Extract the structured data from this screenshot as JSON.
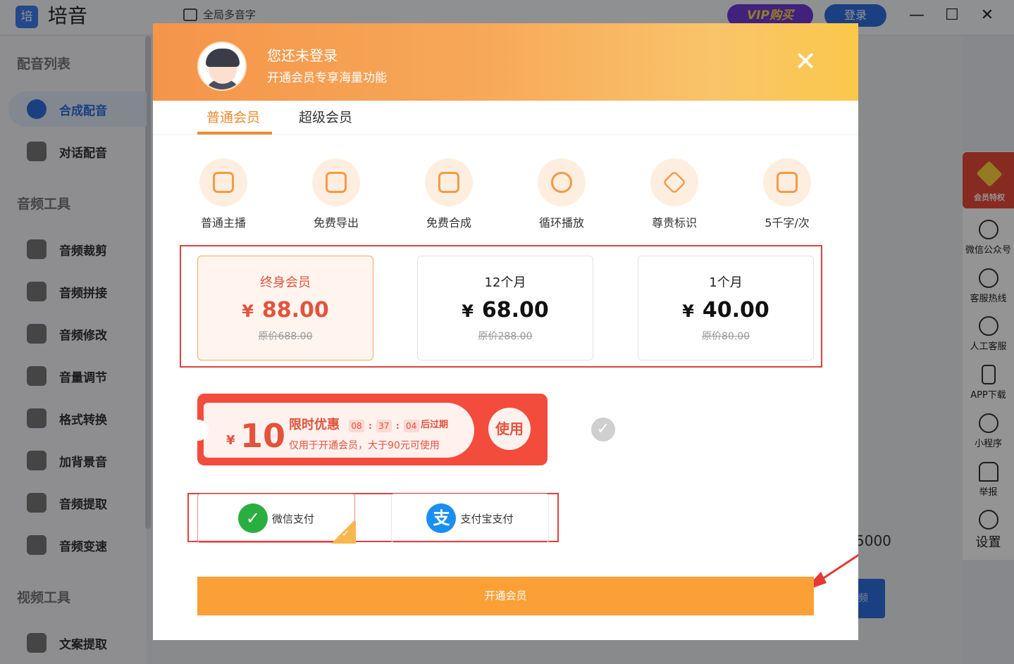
{
  "app": {
    "logo": "培",
    "title": "培音",
    "poly_text": "全局多音字",
    "vip": "VIP购买",
    "login": "登录"
  },
  "window": {
    "min": "—",
    "max": "☐",
    "close": "✕"
  },
  "sidebar": {
    "sections": [
      {
        "title": "配音列表",
        "items": [
          "合成配音",
          "对话配音"
        ]
      },
      {
        "title": "音频工具",
        "items": [
          "音频裁剪",
          "音频拼接",
          "音频修改",
          "音量调节",
          "格式转换",
          "加背景音",
          "音频提取",
          "音频变速"
        ]
      },
      {
        "title": "视频工具",
        "items": [
          "文案提取"
        ]
      }
    ],
    "active": "合成配音"
  },
  "right_panel": {
    "vip_badge": "会员特权",
    "items": [
      "微信公众号",
      "客服热线",
      "人工客服",
      "APP下载",
      "小程序",
      "举报",
      "设置"
    ]
  },
  "background": {
    "partial_number": "5000",
    "partial_button": "频"
  },
  "modal": {
    "title": "您还未登录",
    "subtitle": "开通会员专享海量功能",
    "close": "✕",
    "tabs": [
      "普通会员",
      "超级会员"
    ],
    "active_tab": "普通会员",
    "features": [
      {
        "label": "普通主播",
        "icon": "headset-icon"
      },
      {
        "label": "免费导出",
        "icon": "export-icon"
      },
      {
        "label": "免费合成",
        "icon": "audio-wave-icon"
      },
      {
        "label": "循环播放",
        "icon": "loop-disc-icon"
      },
      {
        "label": "尊贵标识",
        "icon": "diamond-icon"
      },
      {
        "label": "5千字/次",
        "icon": "document-edit-icon"
      }
    ],
    "plans": [
      {
        "name": "终身会员",
        "currency": "¥",
        "price": "88.00",
        "original": "原价688.00",
        "selected": true
      },
      {
        "name": "12个月",
        "currency": "¥",
        "price": "68.00",
        "original": "原价288.00",
        "selected": false
      },
      {
        "name": "1个月",
        "currency": "¥",
        "price": "40.00",
        "original": "原价80.00",
        "selected": false
      }
    ],
    "coupon": {
      "currency": "¥",
      "amount": "10",
      "title": "限时优惠",
      "timer": [
        "08",
        "37",
        "04"
      ],
      "expire_suffix": "后过期",
      "desc": "仅用于开通会员，大于90元可使用",
      "use": "使用"
    },
    "payments": [
      {
        "label": "微信支付",
        "selected": true,
        "color": "#2aae3f"
      },
      {
        "label": "支付宝支付",
        "selected": false,
        "color": "#1a8ff0"
      }
    ],
    "submit": "开通会员"
  },
  "colors": {
    "accent": "#f08a2e",
    "coupon_red": "#f34b3c",
    "submit": "#fba036",
    "highlight_frame": "#e04040"
  }
}
